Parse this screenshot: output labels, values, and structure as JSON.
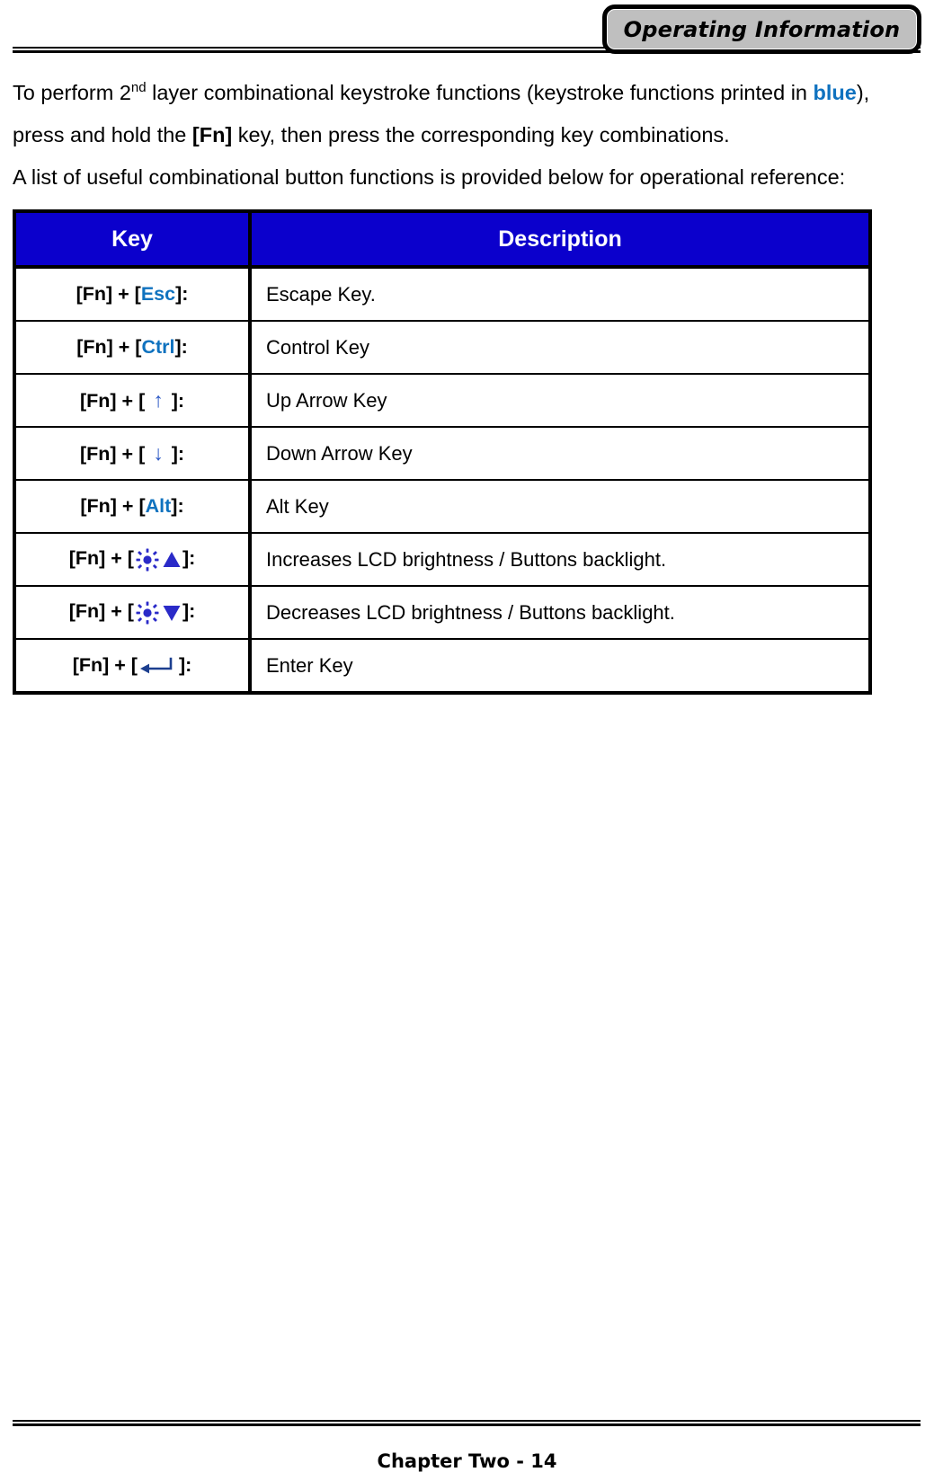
{
  "header": {
    "badge_label": "Operating Information"
  },
  "intro": {
    "line1_part1": "To perform 2",
    "line1_ordinal": "nd",
    "line1_part2": " layer combinational keystroke functions (keystroke functions printed in ",
    "line1_blue": "blue",
    "line1_part3": "),",
    "line2_part1": "press and hold the ",
    "line2_fn": "[Fn]",
    "line2_part2": " key, then press the corresponding key combinations.",
    "line3": "A list of useful combinational button functions is provided below for operational reference:"
  },
  "table": {
    "headers": {
      "key": "Key",
      "description": "Description"
    },
    "rows": [
      {
        "prefix": "[Fn] + [",
        "accent": "Esc",
        "suffix": "]:",
        "icon": "none",
        "description": "Escape Key."
      },
      {
        "prefix": "[Fn] + [",
        "accent": "Ctrl",
        "suffix": "]:",
        "icon": "none",
        "description": "Control Key"
      },
      {
        "prefix": "[Fn] + [ ",
        "accent": "↑",
        "suffix": " ]:",
        "icon": "arrow-up-icon",
        "description": "Up Arrow Key"
      },
      {
        "prefix": "[Fn] + [ ",
        "accent": "↓",
        "suffix": " ]:",
        "icon": "arrow-down-icon",
        "description": "Down Arrow Key"
      },
      {
        "prefix": "[Fn] + [",
        "accent": "Alt",
        "suffix": "]:",
        "icon": "none",
        "description": "Alt Key"
      },
      {
        "prefix": "[Fn] + [",
        "accent": "",
        "suffix": "]:",
        "icon": "brightness-up-icon",
        "description": "Increases LCD brightness / Buttons backlight."
      },
      {
        "prefix": "[Fn] + [",
        "accent": "",
        "suffix": "]:",
        "icon": "brightness-down-icon",
        "description": "Decreases LCD brightness / Buttons backlight."
      },
      {
        "prefix": "[Fn] + [",
        "accent": "",
        "suffix": "]:",
        "icon": "enter-key-icon",
        "description": "Enter Key"
      }
    ]
  },
  "footer": {
    "label": "Chapter Two - 14"
  },
  "colors": {
    "header_blue": "#0b00cc",
    "accent_blue": "#0f72bf",
    "icon_blue": "#2a2ac8",
    "badge_gray": "#bfbfbf"
  }
}
